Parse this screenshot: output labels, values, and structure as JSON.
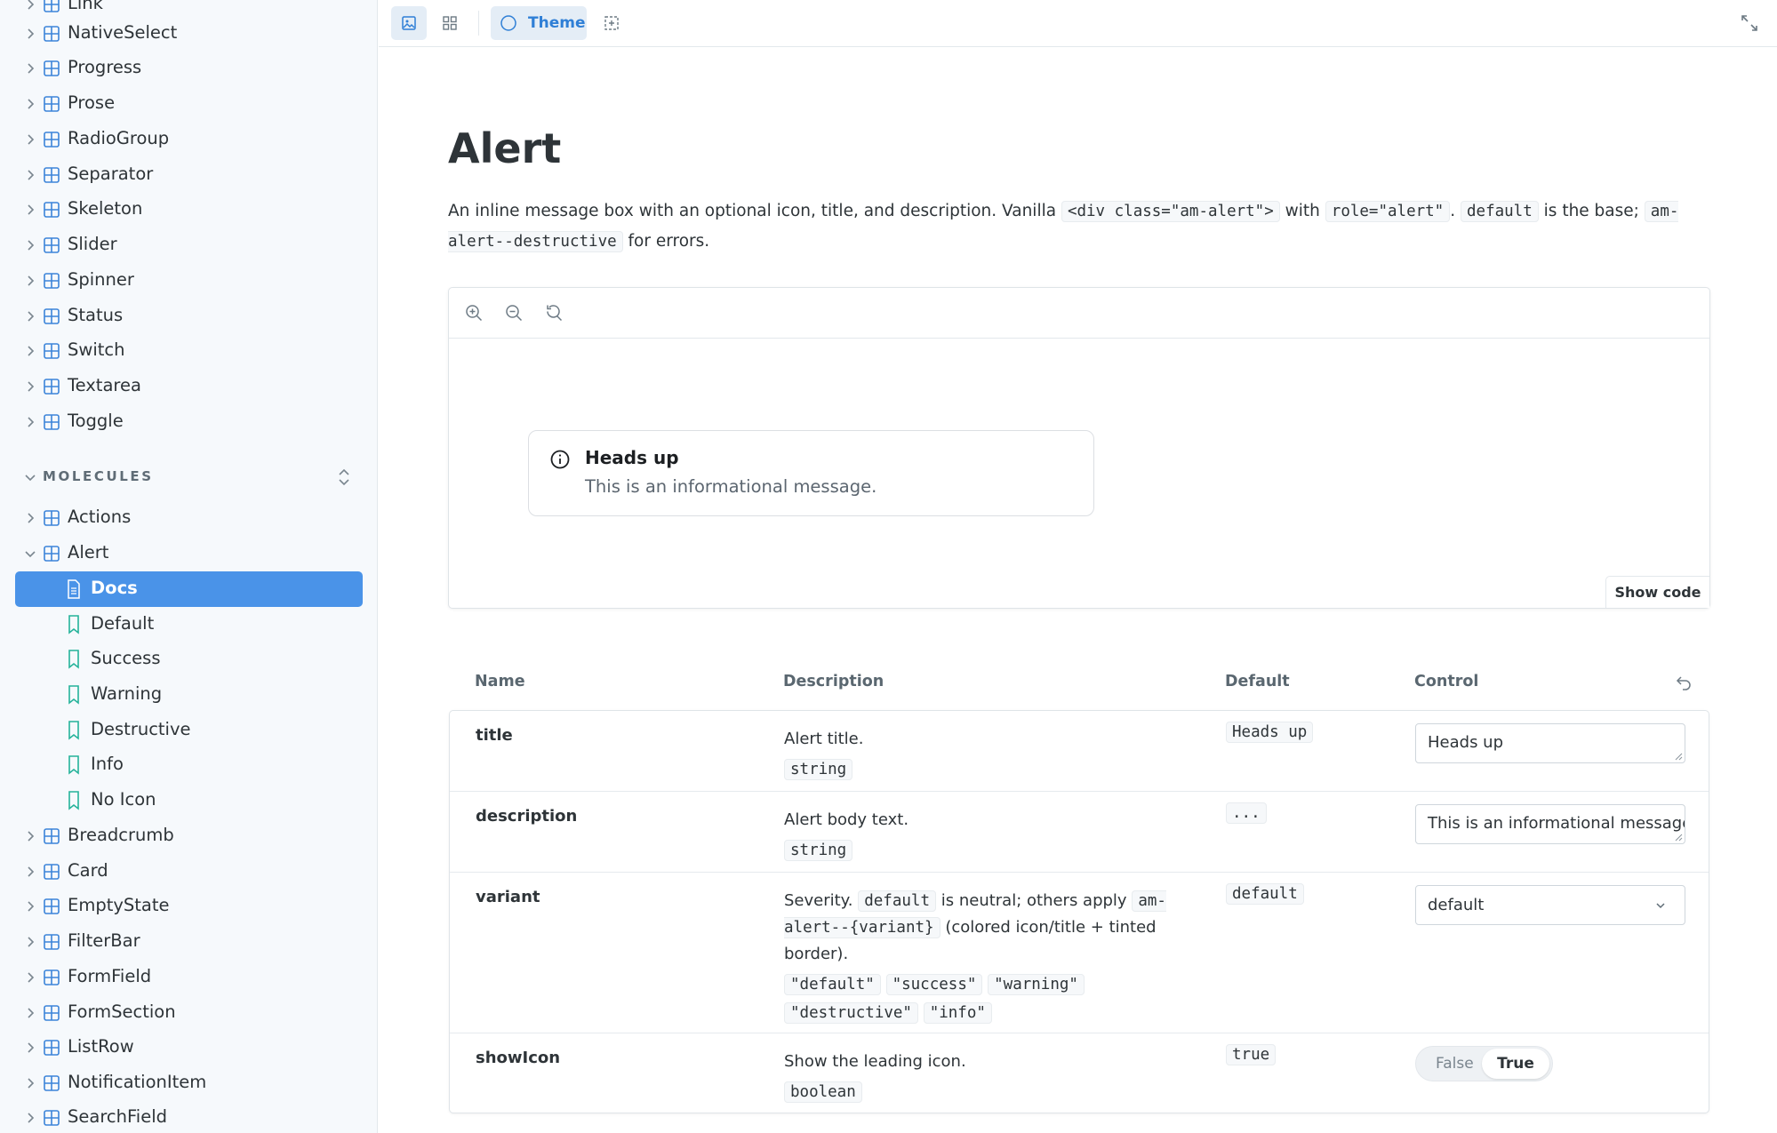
{
  "sidebar": {
    "items_top": [
      {
        "label": "Link"
      },
      {
        "label": "NativeSelect"
      },
      {
        "label": "Progress"
      },
      {
        "label": "Prose"
      },
      {
        "label": "RadioGroup"
      },
      {
        "label": "Separator"
      },
      {
        "label": "Skeleton"
      },
      {
        "label": "Slider"
      },
      {
        "label": "Spinner"
      },
      {
        "label": "Status"
      },
      {
        "label": "Switch"
      },
      {
        "label": "Textarea"
      },
      {
        "label": "Toggle"
      }
    ],
    "molecules_label": "MOLECULES",
    "molecules_items": [
      {
        "label": "Actions"
      },
      {
        "label": "Alert"
      }
    ],
    "alert_stories": [
      {
        "label": "Docs"
      },
      {
        "label": "Default"
      },
      {
        "label": "Success"
      },
      {
        "label": "Warning"
      },
      {
        "label": "Destructive"
      },
      {
        "label": "Info"
      },
      {
        "label": "No Icon"
      }
    ],
    "molecules_rest": [
      {
        "label": "Breadcrumb"
      },
      {
        "label": "Card"
      },
      {
        "label": "EmptyState"
      },
      {
        "label": "FilterBar"
      },
      {
        "label": "FormField"
      },
      {
        "label": "FormSection"
      },
      {
        "label": "ListRow"
      },
      {
        "label": "NotificationItem"
      },
      {
        "label": "SearchField"
      }
    ]
  },
  "toolbar": {
    "theme_label": "Theme"
  },
  "main": {
    "title": "Alert",
    "intro": {
      "part1": "An inline message box with an optional icon, title, and description. Vanilla",
      "code1": "<div class=\"am-alert\">",
      "part2": "with",
      "code2": "role=\"alert\"",
      "part3": ".",
      "code3": "default",
      "part4": "is the base;",
      "code4": "am-alert--destructive",
      "part5": "for errors."
    },
    "preview": {
      "alert_title": "Heads up",
      "alert_description": "This is an informational message.",
      "show_code_label": "Show code"
    },
    "args_table": {
      "headers": {
        "name": "Name",
        "description": "Description",
        "default": "Default",
        "control": "Control"
      },
      "rows": {
        "title": {
          "name": "title",
          "desc": "Alert title.",
          "type": "string",
          "default": "Heads up",
          "control_value": "Heads up"
        },
        "description": {
          "name": "description",
          "desc": "Alert body text.",
          "type": "string",
          "default": "...",
          "control_value": "This is an informational message."
        },
        "variant": {
          "name": "variant",
          "desc_a": "Severity.",
          "desc_code1": "default",
          "desc_b": "is neutral; others apply",
          "desc_code2": "am-alert--{variant}",
          "desc_c": "(colored icon/title + tinted border).",
          "options": [
            "\"default\"",
            "\"success\"",
            "\"warning\"",
            "\"destructive\"",
            "\"info\""
          ],
          "default": "default",
          "control_value": "default"
        },
        "showIcon": {
          "name": "showIcon",
          "desc": "Show the leading icon.",
          "type": "boolean",
          "default": "true",
          "false_label": "False",
          "true_label": "True"
        }
      }
    }
  },
  "colors": {
    "accent": "#4a93e8",
    "accent_text": "#2f7fd6",
    "component_icon": "#3c84d9",
    "story_icon": "#25b39a"
  }
}
